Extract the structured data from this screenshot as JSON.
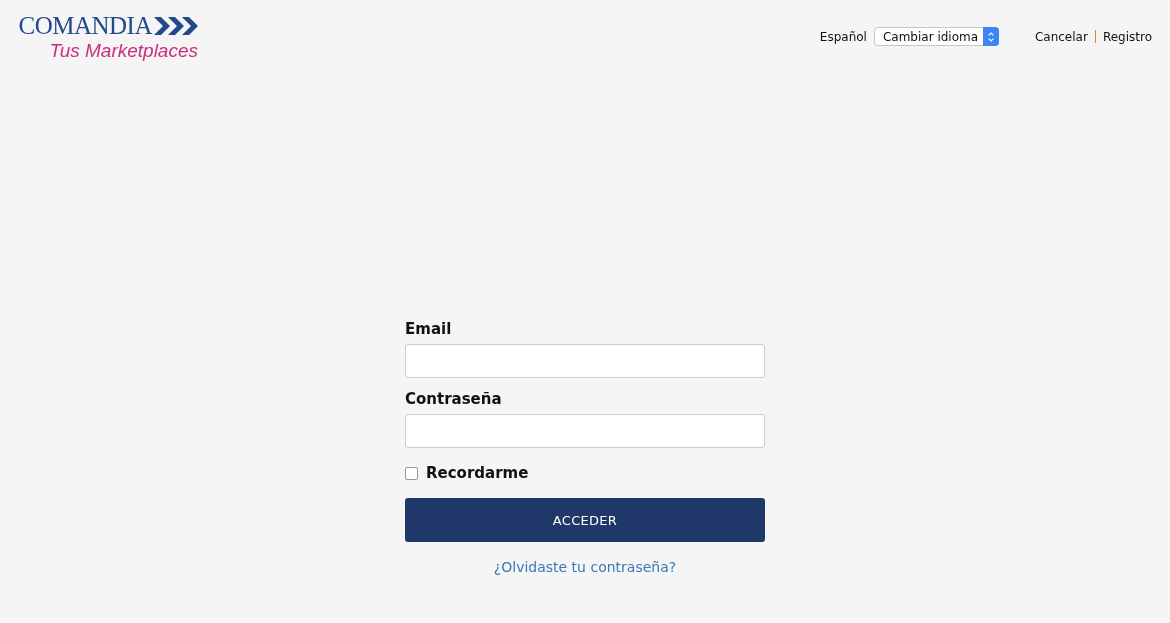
{
  "logo": {
    "name": "COMANDIA",
    "tagline": "Tus Marketplaces"
  },
  "language": {
    "current": "Español",
    "select_value": "Cambiar idioma"
  },
  "header_links": [
    "Cancelar",
    "Registro"
  ],
  "form": {
    "fields": [
      {
        "label": "Email"
      },
      {
        "label": "Contraseña"
      }
    ],
    "remember": {
      "label": "Recordarme",
      "checked": false
    },
    "submit": "ACCEDER",
    "forgot_link": "¿Olvidaste tu contraseña?"
  }
}
